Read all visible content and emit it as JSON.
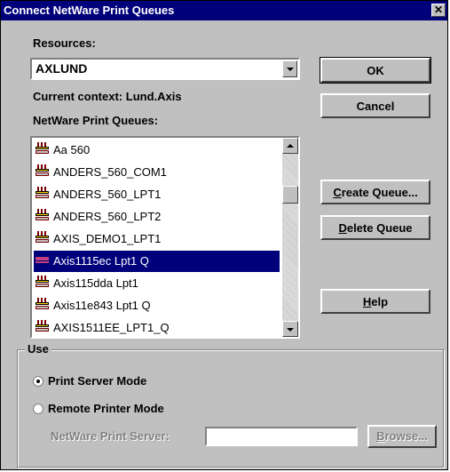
{
  "window": {
    "title": "Connect NetWare Print Queues",
    "close_label": "✕"
  },
  "resources": {
    "label": "Resources:",
    "value": "AXLUND"
  },
  "context": {
    "label": "Current context:",
    "value": "Lund.Axis"
  },
  "queues": {
    "label": "NetWare Print Queues:",
    "items": [
      {
        "label": "Aa 560",
        "selected": false
      },
      {
        "label": "ANDERS_560_COM1",
        "selected": false
      },
      {
        "label": "ANDERS_560_LPT1",
        "selected": false
      },
      {
        "label": "ANDERS_560_LPT2",
        "selected": false
      },
      {
        "label": "AXIS_DEMO1_LPT1",
        "selected": false
      },
      {
        "label": "Axis1115ec Lpt1 Q",
        "selected": true
      },
      {
        "label": "Axis115dda Lpt1",
        "selected": false
      },
      {
        "label": "Axis11e843 Lpt1 Q",
        "selected": false
      },
      {
        "label": "AXIS1511EE_LPT1_Q",
        "selected": false
      }
    ]
  },
  "buttons": {
    "ok": "OK",
    "cancel": "Cancel",
    "create_queue": {
      "mnemonic": "C",
      "rest": "reate Queue..."
    },
    "delete_queue": {
      "mnemonic": "D",
      "rest": "elete Queue"
    },
    "help": {
      "mnemonic": "H",
      "rest": "elp"
    },
    "browse": {
      "mnemonic": "B",
      "rest": "rowse..."
    }
  },
  "use": {
    "title": "Use",
    "print_server_mode": "Print Server Mode",
    "remote_printer_mode": "Remote Printer Mode",
    "selected_mode": "print_server_mode",
    "server_label": "NetWare Print Server:",
    "server_value": ""
  }
}
